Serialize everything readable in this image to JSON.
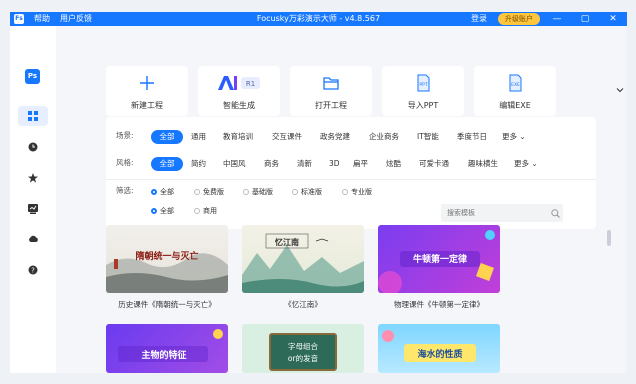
{
  "titlebar": {
    "logo": "Fs",
    "menu": [
      "帮助",
      "用户反馈"
    ],
    "title": "Focusky万彩演示大师 - v4.8.567",
    "login": "登录",
    "upgrade": "升级账户",
    "controls": [
      "—",
      "▢",
      "✕"
    ]
  },
  "sidebar": {
    "logo": "Ps",
    "items": [
      {
        "icon": "grid-icon",
        "active": true
      },
      {
        "icon": "clock-icon",
        "active": false
      },
      {
        "icon": "star-icon",
        "active": false
      },
      {
        "icon": "chart-icon",
        "active": false
      },
      {
        "icon": "cloud-icon",
        "active": false
      },
      {
        "icon": "help-icon",
        "active": false
      }
    ]
  },
  "actions": [
    {
      "label": "新建工程",
      "icon": "plus-icon"
    },
    {
      "label": "智能生成",
      "icon": "ai-icon",
      "badge": "R1",
      "brand": "AI"
    },
    {
      "label": "打开工程",
      "icon": "folder-icon"
    },
    {
      "label": "导入PPT",
      "icon": "ppt-icon"
    },
    {
      "label": "编辑EXE",
      "icon": "exe-icon"
    }
  ],
  "filters": {
    "scene_label": "场景:",
    "scenes": [
      "全部",
      "通用",
      "教育培训",
      "交互课件",
      "政务党建",
      "企业商务",
      "IT智能",
      "季度节日",
      "更多 ⌄"
    ],
    "style_label": "风格:",
    "styles": [
      "全部",
      "简约",
      "中国风",
      "商务",
      "清新",
      "3D",
      "扁平",
      "炫酷",
      "可爱卡通",
      "趣味横生",
      "更多 ⌄"
    ],
    "filter_label": "筛选:",
    "edition": [
      "全部",
      "免费版",
      "基础版",
      "标准版",
      "专业版"
    ],
    "usage": [
      "全部",
      "商用"
    ],
    "search_placeholder": "搜索模板"
  },
  "templates": [
    {
      "caption": "历史课件《隋朝统一与灭亡》",
      "title": "隋朝统一与灭亡"
    },
    {
      "caption": "《忆江南》",
      "title": "忆江南"
    },
    {
      "caption": "物理课件《牛顿第一定律》",
      "title": "牛顿第一定律"
    },
    {
      "caption": "",
      "title": "主物的特征"
    },
    {
      "caption": "",
      "title": "字母组合 or的发音"
    },
    {
      "caption": "",
      "title": "海水的性质"
    }
  ],
  "colors": {
    "accent": "#1677ff",
    "upgrade": "#ffc53d"
  }
}
